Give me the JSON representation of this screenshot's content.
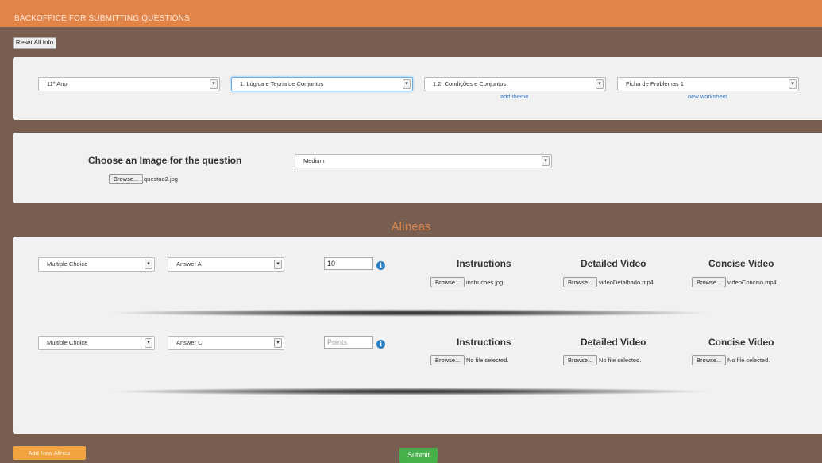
{
  "header": {
    "title": "BACKOFFICE FOR SUBMITTING QUESTIONS"
  },
  "reset_label": "Reset All Info",
  "filters": {
    "year": "11º Ano",
    "chapter": "1. Lógica e Teoria de Conjuntos",
    "theme": "1.2. Condições e Conjuntos",
    "worksheet": "Ficha de Problemas 1",
    "add_theme": "add theme",
    "new_worksheet": "new worksheet"
  },
  "image_section": {
    "heading": "Choose an Image for the question",
    "browse": "Browse...",
    "file": "questao2.jpg",
    "difficulty": "Medium"
  },
  "alineas_title": "Alíneas",
  "alineas": [
    {
      "type": "Multiple Choice",
      "answer": "Answer A",
      "points_value": "10",
      "points_placeholder": "Points",
      "instructions_heading": "Instructions",
      "instructions_file": "instrucoes.jpg",
      "detailed_heading": "Detailed Video",
      "detailed_file": "videoDetalhado.mp4",
      "concise_heading": "Concise Video",
      "concise_file": "videoConciso.mp4",
      "browse": "Browse..."
    },
    {
      "type": "Multiple Choice",
      "answer": "Answer C",
      "points_value": "",
      "points_placeholder": "Points",
      "instructions_heading": "Instructions",
      "instructions_file": "No file selected.",
      "detailed_heading": "Detailed Video",
      "detailed_file": "No file selected.",
      "concise_heading": "Concise Video",
      "concise_file": "No file selected.",
      "browse": "Browse..."
    }
  ],
  "add_alinea_label": "Add New Alinea",
  "submit_label": "Submit",
  "icons": {
    "dropdown": "chevron-down-icon",
    "info": "info-icon"
  },
  "colors": {
    "header": "#e0844a",
    "background": "#775e51",
    "panel": "#f1f1f1",
    "add_button": "#f0a33e",
    "submit_button": "#46b04a",
    "link": "#3d7bbf"
  }
}
